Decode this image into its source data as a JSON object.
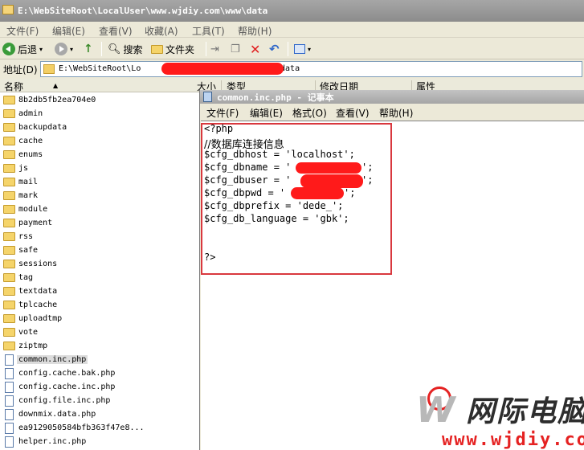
{
  "window": {
    "title": "E:\\WebSiteRoot\\LocalUser\\www.wjdiy.com\\www\\data"
  },
  "menu": [
    "文件(F)",
    "编辑(E)",
    "查看(V)",
    "收藏(A)",
    "工具(T)",
    "帮助(H)"
  ],
  "toolbar": {
    "back": "后退",
    "search": "搜索",
    "folders": "文件夹"
  },
  "address": {
    "label": "地址(D)",
    "value_start": "E:\\WebSiteRoot\\Lo",
    "value_end": "\\data"
  },
  "columns": {
    "name": "名称",
    "size": "大小",
    "type": "类型",
    "modified": "修改日期",
    "attrs": "属性"
  },
  "files": [
    {
      "name": "8b2db5fb2ea704e0",
      "kind": "folder"
    },
    {
      "name": "admin",
      "kind": "folder"
    },
    {
      "name": "backupdata",
      "kind": "folder"
    },
    {
      "name": "cache",
      "kind": "folder"
    },
    {
      "name": "enums",
      "kind": "folder"
    },
    {
      "name": "js",
      "kind": "folder"
    },
    {
      "name": "mail",
      "kind": "folder"
    },
    {
      "name": "mark",
      "kind": "folder"
    },
    {
      "name": "module",
      "kind": "folder"
    },
    {
      "name": "payment",
      "kind": "folder"
    },
    {
      "name": "rss",
      "kind": "folder"
    },
    {
      "name": "safe",
      "kind": "folder"
    },
    {
      "name": "sessions",
      "kind": "folder"
    },
    {
      "name": "tag",
      "kind": "folder"
    },
    {
      "name": "textdata",
      "kind": "folder"
    },
    {
      "name": "tplcache",
      "kind": "folder"
    },
    {
      "name": "uploadtmp",
      "kind": "folder"
    },
    {
      "name": "vote",
      "kind": "folder"
    },
    {
      "name": "ziptmp",
      "kind": "folder"
    },
    {
      "name": "common.inc.php",
      "kind": "file",
      "selected": true
    },
    {
      "name": "config.cache.bak.php",
      "kind": "file"
    },
    {
      "name": "config.cache.inc.php",
      "kind": "file"
    },
    {
      "name": "config.file.inc.php",
      "kind": "file"
    },
    {
      "name": "downmix.data.php",
      "kind": "file"
    },
    {
      "name": "ea9129050584bfb363f47e8...",
      "kind": "file"
    },
    {
      "name": "helper.inc.php",
      "kind": "file"
    }
  ],
  "notepad": {
    "title": "common.inc.php - 记事本",
    "menu": [
      "文件(F)",
      "编辑(E)",
      "格式(O)",
      "查看(V)",
      "帮助(H)"
    ],
    "lines": [
      "<?php",
      "//数据库连接信息",
      "$cfg_dbhost = 'localhost';",
      "$cfg_dbname = '",
      "$cfg_dbuser = '",
      "$cfg_dbpwd = '",
      "$cfg_dbprefix = 'dede_';",
      "$cfg_db_language = 'gbk';",
      "",
      "",
      "?>"
    ],
    "line_ends": [
      "",
      "",
      "",
      "';",
      "';",
      "';",
      "",
      "",
      "",
      "",
      ""
    ]
  },
  "watermark": {
    "brand": "网际电脑",
    "url": "www.wjdiy.com"
  },
  "colors": {
    "redact": "#ff1a1a",
    "highlight": "#d9383e"
  }
}
